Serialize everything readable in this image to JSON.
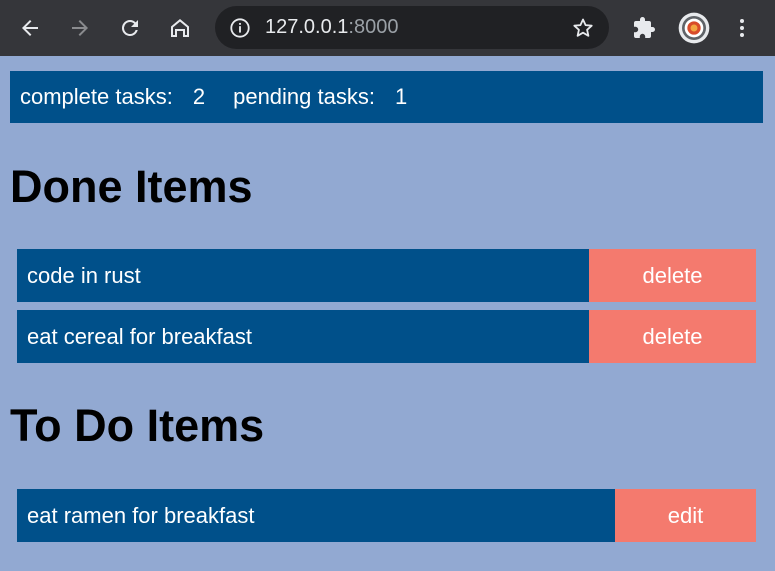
{
  "browser": {
    "url_host": "127.0.0.1",
    "url_port": ":8000"
  },
  "stats": {
    "complete_label": "complete tasks:",
    "complete_count": "2",
    "pending_label": "pending tasks:",
    "pending_count": "1"
  },
  "done": {
    "title": "Done Items",
    "items": [
      {
        "label": "code in rust",
        "action": "delete"
      },
      {
        "label": "eat cereal for breakfast",
        "action": "delete"
      }
    ]
  },
  "todo": {
    "title": "To Do Items",
    "items": [
      {
        "label": "eat ramen for breakfast",
        "action": "edit"
      }
    ]
  },
  "colors": {
    "background": "#92a9d2",
    "bar": "#00508a",
    "button": "#f47a6e"
  }
}
